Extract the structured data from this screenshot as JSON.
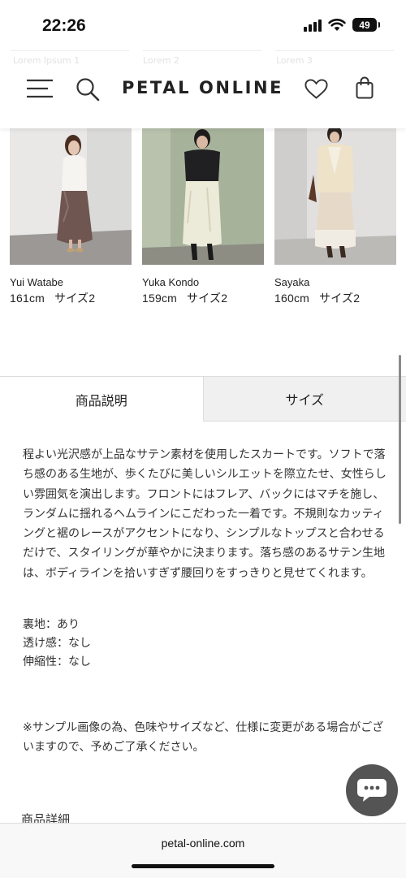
{
  "status_bar": {
    "time": "22:26",
    "battery": "49"
  },
  "header": {
    "logo": "PETAL ONLINE",
    "ghost_text": [
      "Lorem Ipsum 1",
      "Lorem 2",
      "Lorem 3"
    ]
  },
  "models": [
    {
      "name": "Yui Watabe",
      "height": "161cm",
      "size": "サイズ2"
    },
    {
      "name": "Yuka Kondo",
      "height": "159cm",
      "size": "サイズ2"
    },
    {
      "name": "Sayaka",
      "height": "160cm",
      "size": "サイズ2"
    }
  ],
  "tabs": [
    {
      "label": "商品説明",
      "active": true
    },
    {
      "label": "サイズ",
      "active": false
    }
  ],
  "description": "程よい光沢感が上品なサテン素材を使用したスカートです。ソフトで落ち感のある生地が、歩くたびに美しいシルエットを際立たせ、女性らしい雰囲気を演出します。フロントにはフレア、バックにはマチを施し、ランダムに揺れるヘムラインにこだわった一着です。不規則なカッティングと裾のレースがアクセントになり、シンプルなトップスと合わせるだけで、スタイリングが華やかに決まります。落ち感のあるサテン生地は、ボディラインを拾いすぎず腰回りをすっきりと見せてくれます。",
  "specs": [
    "裏地：あり",
    "透け感：なし",
    "伸縮性：なし"
  ],
  "note": "※サンプル画像の為、色味やサイズなど、仕様に変更がある場合がございますので、予めご了承ください。",
  "section_title": "商品詳細",
  "browser": {
    "url": "petal-online.com"
  },
  "icons": [
    "menu-icon",
    "search-icon",
    "heart-icon",
    "bag-icon",
    "chat-icon"
  ],
  "colors": {
    "inactive_tab": "#f0f0f0",
    "chat_button": "#545454"
  }
}
